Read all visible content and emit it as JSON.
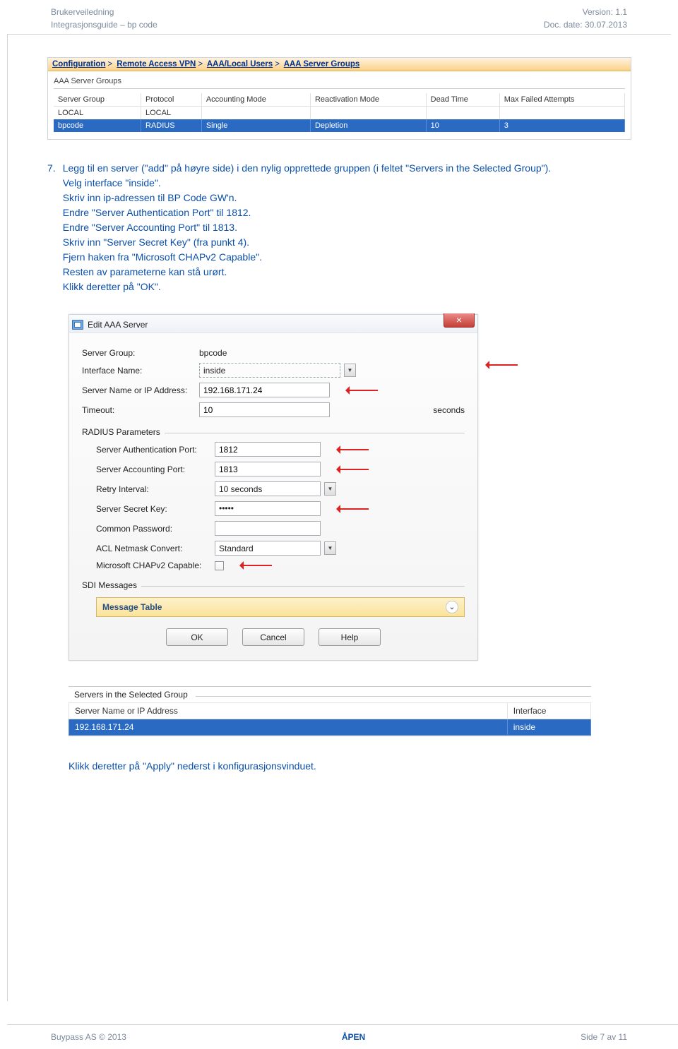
{
  "header": {
    "left_line1": "Brukerveiledning",
    "left_line2": "Integrasjonsguide – bp code",
    "right_line1": "Version: 1.1",
    "right_line2": "Doc. date: 30.07.2013"
  },
  "breadcrumb": {
    "c1": "Configuration",
    "c2": "Remote Access VPN",
    "c3": "AAA/Local Users",
    "c4": "AAA Server Groups"
  },
  "aaa_panel": {
    "title": "AAA Server Groups",
    "headers": [
      "Server Group",
      "Protocol",
      "Accounting Mode",
      "Reactivation Mode",
      "Dead Time",
      "Max Failed Attempts"
    ],
    "rows": [
      {
        "cells": [
          "LOCAL",
          "LOCAL",
          "",
          "",
          "",
          ""
        ],
        "selected": false
      },
      {
        "cells": [
          "bpcode",
          "RADIUS",
          "Single",
          "Depletion",
          "10",
          "3"
        ],
        "selected": true
      }
    ]
  },
  "body": {
    "num": "7.",
    "p1": "Legg til en server (\"add\" på høyre side) i den nylig opprettede gruppen (i feltet \"Servers in the Selected Group\").",
    "p2": "Velg interface \"inside\".",
    "p3": "Skriv inn ip-adressen til BP Code GW'n.",
    "p4": "Endre \"Server Authentication Port\" til 1812.",
    "p5": "Endre \"Server Accounting Port\" til 1813.",
    "p6": "Skriv inn \"Server Secret Key\" (fra punkt 4).",
    "p7": "Fjern haken fra \"Microsoft CHAPv2 Capable\".",
    "p8": "Resten av parameterne kan stå urørt.",
    "p9": "Klikk deretter på \"OK\".",
    "apply_text": "Klikk deretter på \"Apply\" nederst i konfigurasjonsvinduet."
  },
  "dialog": {
    "title": "Edit AAA Server",
    "close_x": "×",
    "server_group_lbl": "Server Group:",
    "server_group_val": "bpcode",
    "iface_lbl": "Interface Name:",
    "iface_val": "inside",
    "ip_lbl": "Server Name or IP Address:",
    "ip_val": "192.168.171.24",
    "timeout_lbl": "Timeout:",
    "timeout_val": "10",
    "timeout_unit": "seconds",
    "radius_section": "RADIUS Parameters",
    "auth_port_lbl": "Server Authentication Port:",
    "auth_port_val": "1812",
    "acct_port_lbl": "Server Accounting Port:",
    "acct_port_val": "1813",
    "retry_lbl": "Retry Interval:",
    "retry_val": "10 seconds",
    "secret_lbl": "Server Secret Key:",
    "secret_val": "•••••",
    "common_lbl": "Common Password:",
    "common_val": "",
    "acl_lbl": "ACL Netmask Convert:",
    "acl_val": "Standard",
    "chap_lbl": "Microsoft CHAPv2 Capable:",
    "sdi_section": "SDI Messages",
    "msg_table": "Message Table",
    "btn_ok": "OK",
    "btn_cancel": "Cancel",
    "btn_help": "Help"
  },
  "servers_group": {
    "title": "Servers in the Selected Group",
    "h1": "Server Name or IP Address",
    "h2": "Interface",
    "v1": "192.168.171.24",
    "v2": "inside"
  },
  "footer": {
    "left": "Buypass AS © 2013",
    "center": "ÅPEN",
    "right": "Side 7 av 11"
  }
}
